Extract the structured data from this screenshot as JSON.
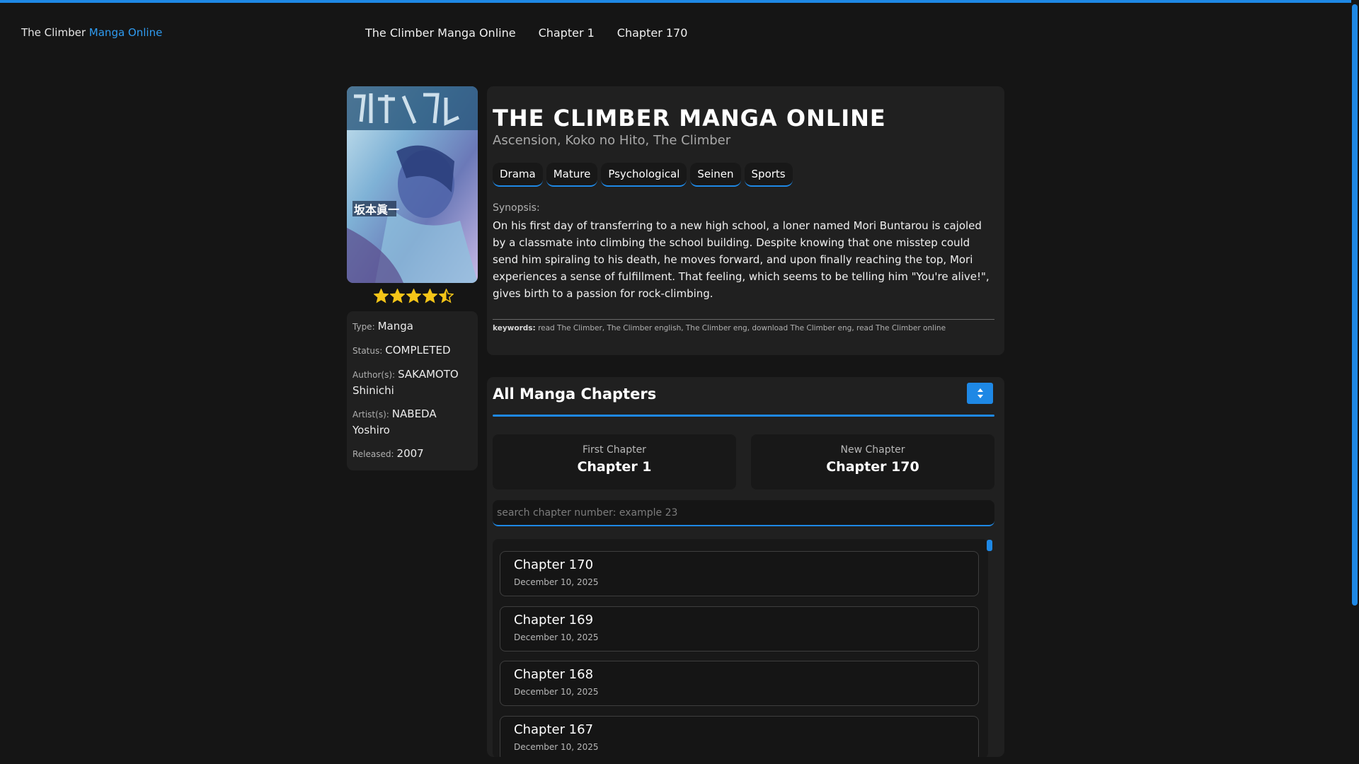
{
  "brand": {
    "prefix": "The Climber",
    "highlight": "Manga Online"
  },
  "nav": {
    "links": [
      "The Climber Manga Online",
      "Chapter 1",
      "Chapter 170"
    ]
  },
  "manga": {
    "title": "THE CLIMBER MANGA ONLINE",
    "alt_titles": "Ascension, Koko no Hito, The Climber",
    "genres": [
      "Drama",
      "Mature",
      "Psychological",
      "Seinen",
      "Sports"
    ],
    "synopsis_label": "Synopsis:",
    "synopsis": "On his first day of transferring to a new high school, a loner named Mori Buntarou is cajoled by a classmate into climbing the school building. Despite knowing that one misstep could send him spiraling to his death, he moves forward, and upon finally reaching the top, Mori experiences a sense of fulfillment. That feeling, which seems to be telling him \"You're alive!\", gives birth to a passion for rock-climbing.",
    "keywords_label": "keywords:",
    "keywords": "read The Climber, The Climber english, The Climber eng, download The Climber eng, read The Climber online",
    "rating": 4.5,
    "cover": {
      "text": "坂本眞一"
    }
  },
  "info": {
    "type_label": "Type:",
    "type": "Manga",
    "status_label": "Status:",
    "status": "COMPLETED",
    "author_label": "Author(s):",
    "author": "SAKAMOTO Shinichi",
    "artist_label": "Artist(s):",
    "artist": "NABEDA Yoshiro",
    "released_label": "Released:",
    "released": "2007"
  },
  "chapters": {
    "heading": "All Manga Chapters",
    "first_label": "First Chapter",
    "first_value": "Chapter 1",
    "new_label": "New Chapter",
    "new_value": "Chapter 170",
    "search_placeholder": "search chapter number: example 23",
    "items": [
      {
        "name": "Chapter 170",
        "date": "December 10, 2025"
      },
      {
        "name": "Chapter 169",
        "date": "December 10, 2025"
      },
      {
        "name": "Chapter 168",
        "date": "December 10, 2025"
      },
      {
        "name": "Chapter 167",
        "date": "December 10, 2025"
      }
    ]
  },
  "colors": {
    "accent": "#1e88e5",
    "star": "#f5c518",
    "background": "#151515",
    "panel": "#202020"
  },
  "icons": {
    "sort": "sort-icon",
    "star": "star-icon",
    "star_half": "star-half-icon"
  }
}
